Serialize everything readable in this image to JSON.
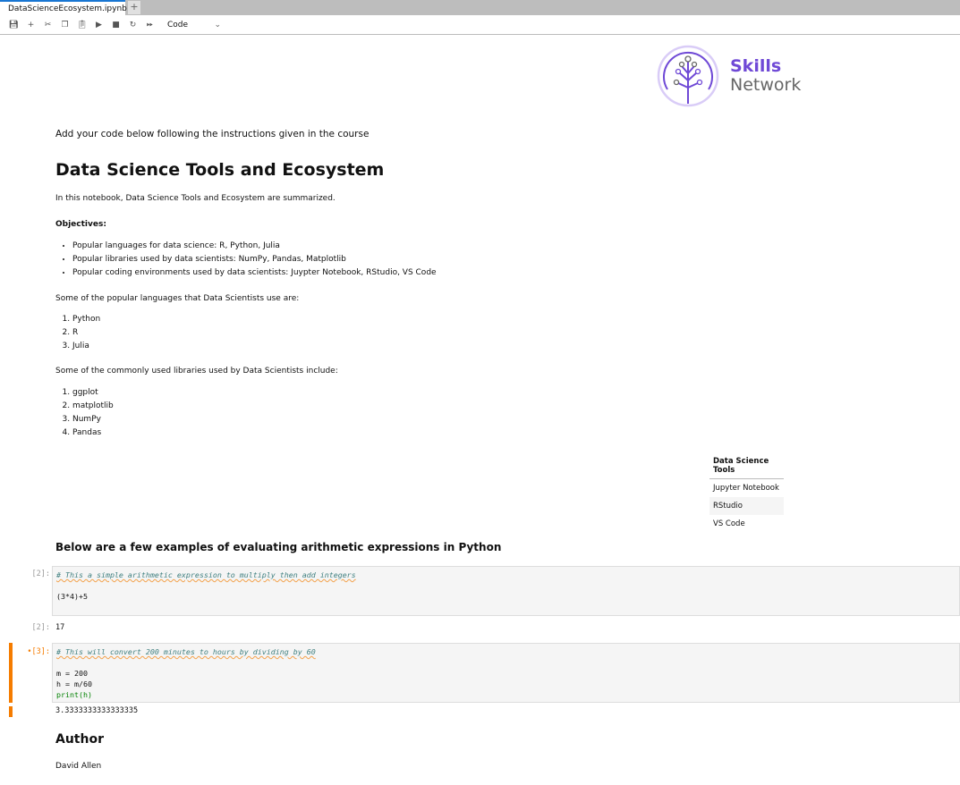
{
  "tab": {
    "title": "DataScienceEcosystem.ipynb",
    "close": "✕",
    "new": "+"
  },
  "toolbar": {
    "cell_type": "Code",
    "chevron": "⌄",
    "icons": [
      "save-icon",
      "add-icon",
      "cut-icon",
      "copy-icon",
      "paste-icon",
      "run-icon",
      "stop-icon",
      "restart-icon",
      "fast-forward-icon"
    ]
  },
  "logo": {
    "line1": "Skills",
    "line2": "Network"
  },
  "notebook": {
    "intro": "Add your code below following the instructions given in the course",
    "title": "Data Science Tools and Ecosystem",
    "summary": "In this notebook, Data Science Tools and Ecosystem are summarized.",
    "objectives_label": "Objectives:",
    "objectives": [
      "Popular languages for data science: R, Python, Julia",
      "Popular libraries used by data scientists: NumPy, Pandas, Matplotlib",
      "Popular coding environments used by data scientists: Juypter Notebook, RStudio, VS Code"
    ],
    "languages_intro": "Some of the popular languages that Data Scientists use are:",
    "languages": [
      "Python",
      "R",
      "Julia"
    ],
    "libraries_intro": "Some of the commonly used libraries used by Data Scientists include:",
    "libraries": [
      "ggplot",
      "matplotlib",
      "NumPy",
      "Pandas"
    ],
    "tools_table": {
      "header": "Data Science Tools",
      "rows": [
        "Jupyter Notebook",
        "RStudio",
        "VS Code"
      ]
    },
    "examples_heading": "Below are a few examples of evaluating arithmetic expressions in Python",
    "cell1": {
      "prompt": "[2]:",
      "comment": "# This a simple arithmetic expression to multiply then add integers",
      "code": "(3*4)+5",
      "out_prompt": "[2]:",
      "output": "17"
    },
    "cell2": {
      "prompt": "•[3]:",
      "comment": "# This will convert 200 minutes to hours by dividing by 60",
      "line1": "m = 200",
      "line2": "h = m/60",
      "line3": "print(h)",
      "output": "3.3333333333333335"
    },
    "author_heading": "Author",
    "author": "David Allen"
  }
}
